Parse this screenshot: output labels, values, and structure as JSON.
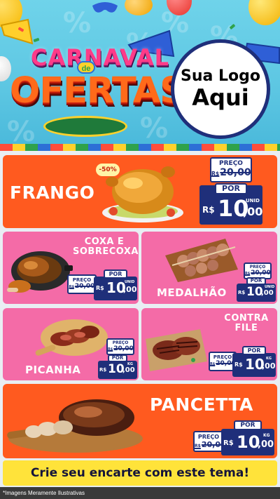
{
  "header": {
    "carnaval_word": "CARNAVAL",
    "de_word": "de",
    "ofertas_word": "OFERTAS",
    "logo_line1": "Sua Logo",
    "logo_line2": "Aqui",
    "colors": {
      "sky": "#5cc6e2",
      "logo_border": "#1f2f7a"
    }
  },
  "products": {
    "frango": {
      "name": "FRANGO",
      "discount_badge": "-50%",
      "old_label": "PREÇO",
      "old_currency": "R$",
      "old_price": "20,00",
      "new_label": "POR",
      "new_currency": "R$",
      "new_price_int": "10",
      "new_price_cents": ",00",
      "unit": "UNID"
    },
    "coxa": {
      "name_line1": "COXA E",
      "name_line2": "SOBRECOXA",
      "old_label": "PREÇO",
      "old_currency": "R$",
      "old_price": "20,00",
      "new_label": "POR",
      "new_currency": "R$",
      "new_price_int": "10",
      "new_price_cents": ",00",
      "unit": "UNID"
    },
    "medalhao": {
      "name": "MEDALHÃO",
      "old_label": "PREÇO",
      "old_currency": "R$",
      "old_price": "20,00",
      "new_label": "POR",
      "new_currency": "R$",
      "new_price_int": "10",
      "new_price_cents": ",00",
      "unit": "UNID"
    },
    "picanha": {
      "name": "PICANHA",
      "old_label": "PREÇO",
      "old_currency": "R$",
      "old_price": "20,00",
      "new_label": "POR",
      "new_currency": "R$",
      "new_price_int": "10",
      "new_price_cents": ",00",
      "unit": "KG"
    },
    "contrafile": {
      "name_line1": "CONTRA",
      "name_line2": "FILE",
      "old_label": "PREÇO",
      "old_currency": "R$",
      "old_price": "20,00",
      "new_label": "POR",
      "new_currency": "R$",
      "new_price_int": "10",
      "new_price_cents": ",00",
      "unit": "KG"
    },
    "pancetta": {
      "name": "PANCETTA",
      "old_label": "PREÇO",
      "old_currency": "R$",
      "old_price": "20,00",
      "new_label": "POR",
      "new_currency": "R$",
      "new_price_int": "10",
      "new_price_cents": ",00",
      "unit": "KG"
    }
  },
  "cta": {
    "text": "Crie seu encarte com este tema!"
  },
  "footer": {
    "disclaimer": "*Imagens Meramente Ilustrativas"
  },
  "colors": {
    "orange_panel": "#ff5a1f",
    "pink_panel": "#f46ba7",
    "price_navy": "#1f2f7a",
    "cta_yellow": "#ffe33a"
  },
  "icons": [
    "balloon-icon",
    "trumpet-icon",
    "roast-chicken-image",
    "chicken-leg-pan-image",
    "medallion-skewers-image",
    "picanha-board-image",
    "contrafile-steak-image",
    "pancetta-roast-image"
  ]
}
